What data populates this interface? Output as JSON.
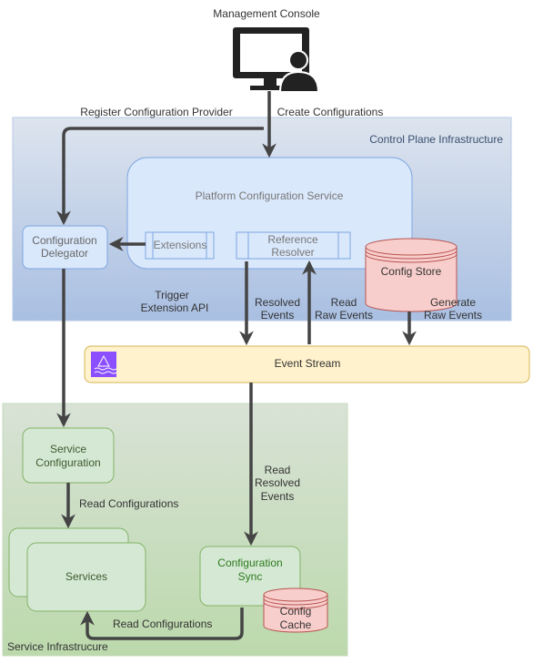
{
  "top": {
    "console_label": "Management Console"
  },
  "edges": {
    "register": "Register Configuration Provider",
    "create": "Create Configurations",
    "trigger": [
      "Trigger",
      "Extension API"
    ],
    "resolved": [
      "Resolved",
      "Events"
    ],
    "read_raw": [
      "Read",
      "Raw Events"
    ],
    "generate": [
      "Generate",
      "Raw Events"
    ],
    "read_resolved": [
      "Read",
      "Resolved",
      "Events"
    ],
    "read_config_1": "Read Configurations",
    "read_config_2": "Read Configurations"
  },
  "control_plane": {
    "title": "Control Plane Infrastructure",
    "platform_service": "Platform Configuration Service",
    "extensions": "Extensions",
    "reference_resolver": [
      "Reference",
      "Resolver"
    ],
    "config_delegator": [
      "Configuration",
      "Delegator"
    ],
    "config_store": "Config Store"
  },
  "event_stream": {
    "label": "Event Stream"
  },
  "service_infra": {
    "title": "Service Infrastrucure",
    "service_configuration": [
      "Service",
      "Configuration"
    ],
    "services": "Services",
    "configuration_sync": [
      "Configuration",
      "Sync"
    ],
    "config_cache": [
      "Config",
      "Cache"
    ]
  },
  "colors": {
    "control_plane": "#c3d3ea",
    "service_infra": "#c7dfba",
    "event_stream": "#fff2cc",
    "config_store": "#f8cecc",
    "arrow": "#444444",
    "kinesis_icon": "#8c4fff"
  }
}
